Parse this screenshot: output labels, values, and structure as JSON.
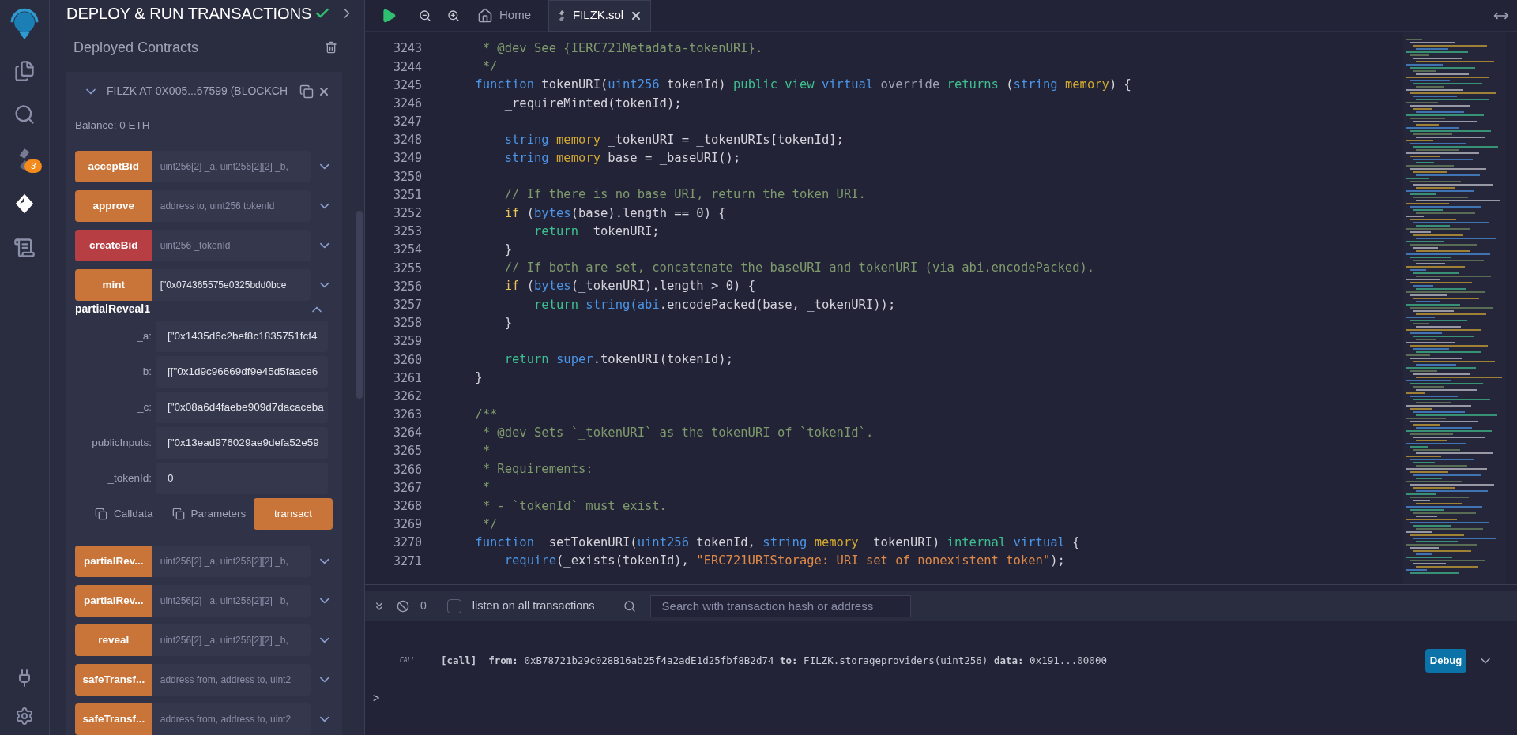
{
  "icon_bar": {
    "badge": "3"
  },
  "panel": {
    "title": "DEPLOY & RUN TRANSACTIONS",
    "section": "Deployed Contracts",
    "contract": {
      "title": "FILZK AT 0X005...67599 (BLOCKCH",
      "expanded": true,
      "balance": "Balance: 0 ETH",
      "functions": [
        {
          "kind": "collapsed",
          "name": "acceptBid",
          "color": "#c97539",
          "placeholder": "uint256[2] _a, uint256[2][2] _b,"
        },
        {
          "kind": "collapsed",
          "name": "approve",
          "color": "#c97539",
          "placeholder": "address to, uint256 tokenId"
        },
        {
          "kind": "collapsed",
          "name": "createBid",
          "color": "#b73e43",
          "placeholder": "uint256 _tokenId"
        },
        {
          "kind": "collapsed",
          "name": "mint",
          "color": "#c97539",
          "value": "[\"0x074365575e0325bdd0bce"
        },
        {
          "kind": "expanded",
          "name": "partialReveal1",
          "color": "#c97539",
          "params": [
            {
              "label": "_a:",
              "value": "[\"0x1435d6c2bef8c1835751fcf4"
            },
            {
              "label": "_b:",
              "value": "[[\"0x1d9c96669df9e45d5faace6"
            },
            {
              "label": "_c:",
              "value": "[\"0x08a6d4faebe909d7dacaceba"
            },
            {
              "label": "_publicInputs:",
              "value": "[\"0x13ead976029ae9defa52e59"
            },
            {
              "label": "_tokenId:",
              "value": "0"
            }
          ],
          "calldata": "Calldata",
          "parameters": "Parameters",
          "action": "transact"
        },
        {
          "kind": "collapsed",
          "name": "partialRev...",
          "color": "#c97539",
          "placeholder": "uint256[2] _a, uint256[2][2] _b,"
        },
        {
          "kind": "collapsed",
          "name": "partialRev...",
          "color": "#c97539",
          "placeholder": "uint256[2] _a, uint256[2][2] _b,"
        },
        {
          "kind": "collapsed",
          "name": "reveal",
          "color": "#c97539",
          "placeholder": "uint256[2] _a, uint256[2][2] _b,"
        },
        {
          "kind": "collapsed",
          "name": "safeTransf...",
          "color": "#c97539",
          "placeholder": "address from, address to, uint2"
        },
        {
          "kind": "collapsed",
          "name": "safeTransf...",
          "color": "#c97539",
          "placeholder": "address from, address to, uint2"
        }
      ]
    }
  },
  "tabs": [
    {
      "label": "Home",
      "kind": "home",
      "selected": false
    },
    {
      "label": "FILZK.sol",
      "kind": "file",
      "selected": true
    }
  ],
  "code": [
    {
      "number": "3243",
      "tokens": [
        {
          "kind": "comment",
          "text": "     * @dev See {IERC721Metadata-tokenURI}."
        }
      ]
    },
    {
      "number": "3244",
      "tokens": [
        {
          "kind": "comment",
          "text": "     */"
        }
      ]
    },
    {
      "number": "3245",
      "tokens": [
        {
          "kind": "keyword",
          "text": "    function"
        },
        {
          "kind": "plain",
          "text": " tokenURI("
        },
        {
          "kind": "keyword",
          "text": "uint256"
        },
        {
          "kind": "plain",
          "text": " tokenId) "
        },
        {
          "kind": "modifier",
          "text": "public view "
        },
        {
          "kind": "keyword",
          "text": "virtual"
        },
        {
          "kind": "muted",
          "text": " override "
        },
        {
          "kind": "modifier",
          "text": "returns"
        },
        {
          "kind": "plain",
          "text": " ("
        },
        {
          "kind": "keyword",
          "text": "string "
        },
        {
          "kind": "storage",
          "text": "memory"
        },
        {
          "kind": "plain",
          "text": ") {"
        }
      ]
    },
    {
      "number": "3246",
      "tokens": [
        {
          "kind": "plain",
          "text": "        _requireMinted(tokenId);"
        }
      ]
    },
    {
      "number": "3247"
    },
    {
      "number": "3248",
      "tokens": [
        {
          "kind": "keyword",
          "text": "        string "
        },
        {
          "kind": "storage",
          "text": "memory"
        },
        {
          "kind": "plain",
          "text": " _tokenURI = _tokenURIs[tokenId];"
        }
      ]
    },
    {
      "number": "3249",
      "tokens": [
        {
          "kind": "keyword",
          "text": "        string "
        },
        {
          "kind": "storage",
          "text": "memory"
        },
        {
          "kind": "plain",
          "text": " base = _baseURI();"
        }
      ]
    },
    {
      "number": "3250"
    },
    {
      "number": "3251",
      "tokens": [
        {
          "kind": "comment",
          "text": "        // If there is no base URI, return the token URI."
        }
      ]
    },
    {
      "number": "3252",
      "tokens": [
        {
          "kind": "control",
          "text": "        if"
        },
        {
          "kind": "plain",
          "text": " ("
        },
        {
          "kind": "keyword",
          "text": "bytes"
        },
        {
          "kind": "plain",
          "text": "(base).length == 0) {"
        }
      ]
    },
    {
      "number": "3253",
      "tokens": [
        {
          "kind": "modifier",
          "text": "            return"
        },
        {
          "kind": "plain",
          "text": " _tokenURI;"
        }
      ]
    },
    {
      "number": "3254",
      "tokens": [
        {
          "kind": "plain",
          "text": "        }"
        }
      ]
    },
    {
      "number": "3255",
      "tokens": [
        {
          "kind": "comment",
          "text": "        // If both are set, concatenate the baseURI and tokenURI (via abi.encodePacked)."
        }
      ]
    },
    {
      "number": "3256",
      "tokens": [
        {
          "kind": "control",
          "text": "        if"
        },
        {
          "kind": "plain",
          "text": " ("
        },
        {
          "kind": "keyword",
          "text": "bytes"
        },
        {
          "kind": "plain",
          "text": "(_tokenURI).length > 0) {"
        }
      ]
    },
    {
      "number": "3257",
      "tokens": [
        {
          "kind": "modifier",
          "text": "            return "
        },
        {
          "kind": "keyword",
          "text": "string("
        },
        {
          "kind": "keyword",
          "text": "abi"
        },
        {
          "kind": "plain",
          "text": ".encodePacked(base, _tokenURI));"
        }
      ]
    },
    {
      "number": "3258",
      "tokens": [
        {
          "kind": "plain",
          "text": "        }"
        }
      ]
    },
    {
      "number": "3259"
    },
    {
      "number": "3260",
      "tokens": [
        {
          "kind": "modifier",
          "text": "        return "
        },
        {
          "kind": "keyword",
          "text": "super"
        },
        {
          "kind": "plain",
          "text": ".tokenURI(tokenId);"
        }
      ]
    },
    {
      "number": "3261",
      "tokens": [
        {
          "kind": "plain",
          "text": "    }"
        }
      ]
    },
    {
      "number": "3262"
    },
    {
      "number": "3263",
      "tokens": [
        {
          "kind": "comment",
          "text": "    /**"
        }
      ]
    },
    {
      "number": "3264",
      "tokens": [
        {
          "kind": "comment",
          "text": "     * @dev Sets `_tokenURI` as the tokenURI of `tokenId`."
        }
      ]
    },
    {
      "number": "3265",
      "tokens": [
        {
          "kind": "comment",
          "text": "     *"
        }
      ]
    },
    {
      "number": "3266",
      "tokens": [
        {
          "kind": "comment",
          "text": "     * Requirements:"
        }
      ]
    },
    {
      "number": "3267",
      "tokens": [
        {
          "kind": "comment",
          "text": "     *"
        }
      ]
    },
    {
      "number": "3268",
      "tokens": [
        {
          "kind": "comment",
          "text": "     * - `tokenId` must exist."
        }
      ]
    },
    {
      "number": "3269",
      "tokens": [
        {
          "kind": "comment",
          "text": "     */"
        }
      ]
    },
    {
      "number": "3270",
      "tokens": [
        {
          "kind": "keyword",
          "text": "    function"
        },
        {
          "kind": "plain",
          "text": " _setTokenURI("
        },
        {
          "kind": "keyword",
          "text": "uint256"
        },
        {
          "kind": "plain",
          "text": " tokenId, "
        },
        {
          "kind": "keyword",
          "text": "string "
        },
        {
          "kind": "storage",
          "text": "memory"
        },
        {
          "kind": "plain",
          "text": " _tokenURI) "
        },
        {
          "kind": "modifier",
          "text": "internal "
        },
        {
          "kind": "keyword",
          "text": "virtual"
        },
        {
          "kind": "plain",
          "text": " {"
        }
      ]
    },
    {
      "number": "3271",
      "tokens": [
        {
          "kind": "keyword",
          "text": "        require"
        },
        {
          "kind": "plain",
          "text": "(_exists(tokenId), "
        },
        {
          "kind": "string",
          "text": "\"ERC721URIStorage: URI set of nonexistent token\""
        },
        {
          "kind": "plain",
          "text": ");"
        }
      ]
    }
  ],
  "terminal": {
    "count": "0",
    "listen": {
      "label": "listen on all transactions",
      "checked": false
    },
    "search": {
      "placeholder": "Search with transaction hash or address"
    },
    "log": {
      "tag": "CALL",
      "text": "**[call]**  **from:** 0xB78721b29c028B16ab25f4a2adE1d25fbf8B2d74 **to:** FILZK.storageproviders(uint256) **data:** 0x191...00000",
      "action": "Debug"
    },
    "prompt": ">"
  }
}
